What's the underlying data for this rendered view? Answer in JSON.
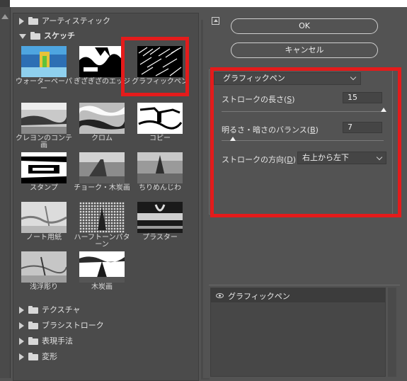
{
  "categories": {
    "artistic": "アーティスティック",
    "sketch": "スケッチ",
    "texture": "テクスチャ",
    "brush_strokes": "ブラシストローク",
    "stylize": "表現手法",
    "distort": "変形"
  },
  "thumbnails": [
    {
      "label": "ウォーターペーパー"
    },
    {
      "label": "ぎざぎざのエッジ"
    },
    {
      "label": "グラフィックペン"
    },
    {
      "label": "クレヨンのコンテ画"
    },
    {
      "label": "クロム"
    },
    {
      "label": "コピー"
    },
    {
      "label": "スタンプ"
    },
    {
      "label": "チョーク・木炭画"
    },
    {
      "label": "ちりめんじわ"
    },
    {
      "label": "ノート用紙"
    },
    {
      "label": "ハーフトーンパターン"
    },
    {
      "label": "プラスター"
    },
    {
      "label": "浅浮彫り"
    },
    {
      "label": "木炭画"
    }
  ],
  "buttons": {
    "ok": "OK",
    "cancel": "キャンセル"
  },
  "filter": {
    "selected": "グラフィックペン",
    "stroke_length_label": "ストロークの長さ(",
    "stroke_length_key": "S",
    "stroke_length_value": "15",
    "balance_label": "明るさ・暗さのバランス(",
    "balance_key": "B",
    "balance_value": "7",
    "direction_label": "ストロークの方向(",
    "direction_key": "D",
    "direction_value": "右上から左下",
    "paren_close": ")",
    "paren_close_colon": ")："
  },
  "layers": [
    {
      "name": "グラフィックペン"
    }
  ],
  "icons": {
    "expand": "triangle-right-icon",
    "collapse": "triangle-down-icon",
    "folder": "folder-icon",
    "eye": "eye-icon"
  },
  "colors": {
    "highlight": "#e41b1b",
    "panel": "#535353"
  }
}
